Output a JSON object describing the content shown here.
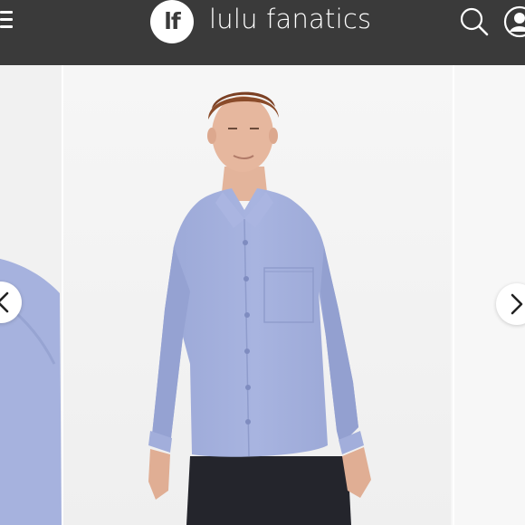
{
  "header": {
    "logo_text": "lf",
    "brand_name": "lulu fanatics",
    "icons": {
      "menu": "menu-icon",
      "search": "search-icon",
      "profile": "profile-icon"
    }
  },
  "carousel": {
    "product_image": "product-photo",
    "prev_icon": "chevron-left-icon",
    "next_icon": "chevron-right-icon"
  },
  "colors": {
    "header_bg": "#3a3a3a",
    "shirt": "#a3b0dd",
    "pants": "#24252c",
    "background": "#f4f4f4"
  }
}
